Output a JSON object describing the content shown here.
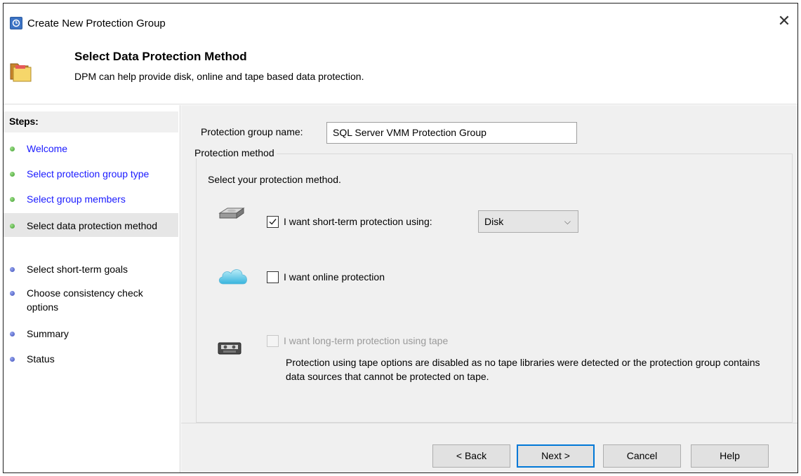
{
  "window": {
    "title": "Create New Protection Group",
    "close_glyph": "✕"
  },
  "header": {
    "title": "Select Data Protection Method",
    "subtitle": "DPM can help provide disk, online and tape based data protection.",
    "icon": "folder-icon"
  },
  "steps": {
    "heading": "Steps:",
    "items": [
      {
        "label": "Welcome",
        "status": "done"
      },
      {
        "label": "Select protection group type",
        "status": "done"
      },
      {
        "label": "Select group members",
        "status": "done"
      },
      {
        "label": "Select data protection method",
        "status": "current"
      },
      {
        "label": "Select short-term goals",
        "status": "pending"
      },
      {
        "label": "Choose consistency check options",
        "status": "pending"
      },
      {
        "label": "Summary",
        "status": "pending"
      },
      {
        "label": "Status",
        "status": "pending"
      }
    ]
  },
  "form": {
    "group_name_label": "Protection group name:",
    "group_name_value": "SQL Server VMM Protection Group",
    "method_legend": "Protection method",
    "method_desc": "Select your protection method.",
    "short_term": {
      "label": "I want short-term protection using:",
      "checked": true,
      "icon": "disk-drive-icon"
    },
    "short_term_select": {
      "value": "Disk",
      "chevron": "⌵"
    },
    "online": {
      "label": "I want online protection",
      "checked": false,
      "icon": "cloud-icon"
    },
    "tape": {
      "label": "I want long-term protection using tape",
      "checked": false,
      "disabled": true,
      "icon": "tape-icon",
      "note": "Protection using tape options are disabled as no tape libraries were detected or the protection group contains data sources that cannot be protected on tape."
    }
  },
  "buttons": {
    "back": "< Back",
    "next": "Next >",
    "cancel": "Cancel",
    "help": "Help"
  },
  "colors": {
    "link": "#1a1aff",
    "step_done": "#3d9c2e",
    "step_pending": "#3a4cb8",
    "default_button_border": "#0078d7"
  }
}
